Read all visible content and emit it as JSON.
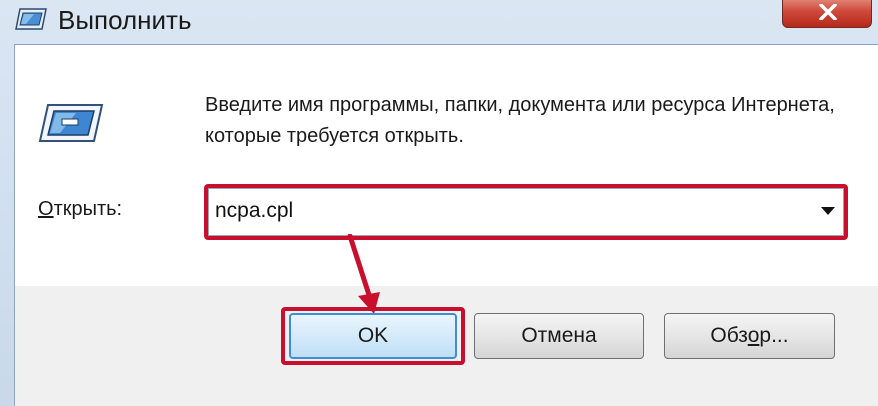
{
  "window": {
    "title": "Выполнить",
    "icon": "run-icon",
    "close_icon": "close-icon"
  },
  "dialog": {
    "description": "Введите имя программы, папки, документа или ресурса Интернета, которые требуется открыть.",
    "open_label_prefix": "О",
    "open_label_rest": "ткрыть:",
    "input_value": "ncpa.cpl"
  },
  "buttons": {
    "ok": "OK",
    "cancel": "Отмена",
    "browse_prefix": "Обз",
    "browse_underlined": "о",
    "browse_rest": "р..."
  },
  "colors": {
    "highlight": "#c8102e",
    "close_button": "#c6382a"
  }
}
